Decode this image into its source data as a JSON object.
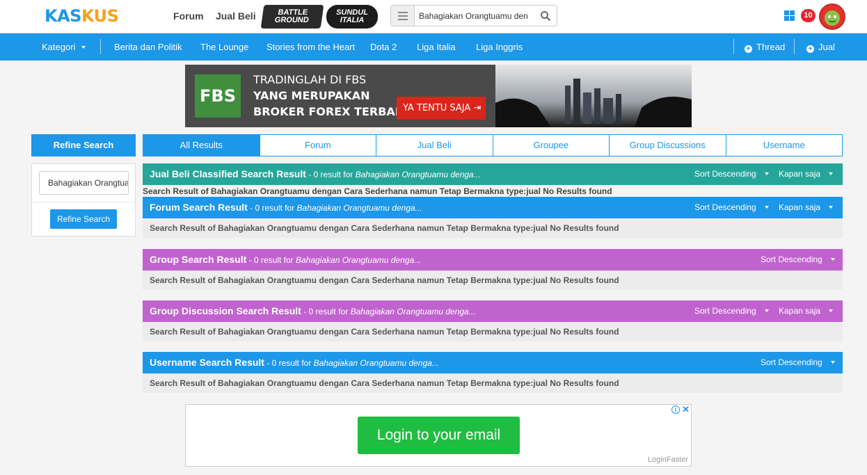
{
  "header": {
    "logo_part1": "KAS",
    "logo_part2": "KUS",
    "nav": [
      "Forum",
      "Jual Beli"
    ],
    "badge_battleground": "BATTLE GROUND",
    "badge_sundul": "SUNDUL ITALIA",
    "search_value": "Bahagiakan Orangtuamu den",
    "notification_count": "10"
  },
  "navbar": {
    "kategori": "Kategori",
    "items": [
      "Berita dan Politik",
      "The Lounge",
      "Stories from the Heart",
      "Dota 2",
      "Liga Italia",
      "Liga Inggris"
    ],
    "thread": "Thread",
    "jual": "Jual"
  },
  "banner": {
    "logo": "FBS",
    "line1": "TRADINGLAH DI FBS",
    "line2": "YANG MERUPAKAN",
    "line3": "BROKER FOREX TERBAIK",
    "cta": "YA TENTU SAJA"
  },
  "sidebar": {
    "title": "Refine Search",
    "input_value": "Bahagiakan Orangtuamu",
    "button": "Refine Search"
  },
  "tabs": [
    "All Results",
    "Forum",
    "Jual Beli",
    "Groupee",
    "Group Discussions",
    "Username"
  ],
  "results": {
    "query": "Bahagiakan Orangtuamu denga...",
    "count_text": "- 0 result for",
    "sort_label": "Sort Descending",
    "time_label": "Kapan saja",
    "no_result_text": "Search Result of Bahagiakan Orangtuamu dengan Cara Sederhana namun Tetap Bermakna type:jual No Results found",
    "jualbeli_title": "Jual Beli Classified Search Result",
    "forum_title": "Forum Search Result",
    "group_title": "Group Search Result",
    "groupdisc_title": "Group Discussion Search Result",
    "username_title": "Username Search Result"
  },
  "colors": {
    "primary": "#1d97e8",
    "jualbeli": "#26a69a",
    "group": "#c163cf"
  },
  "ad": {
    "button": "Login to your email",
    "brand": "LoginFaster",
    "info": "i",
    "close": "✕"
  }
}
